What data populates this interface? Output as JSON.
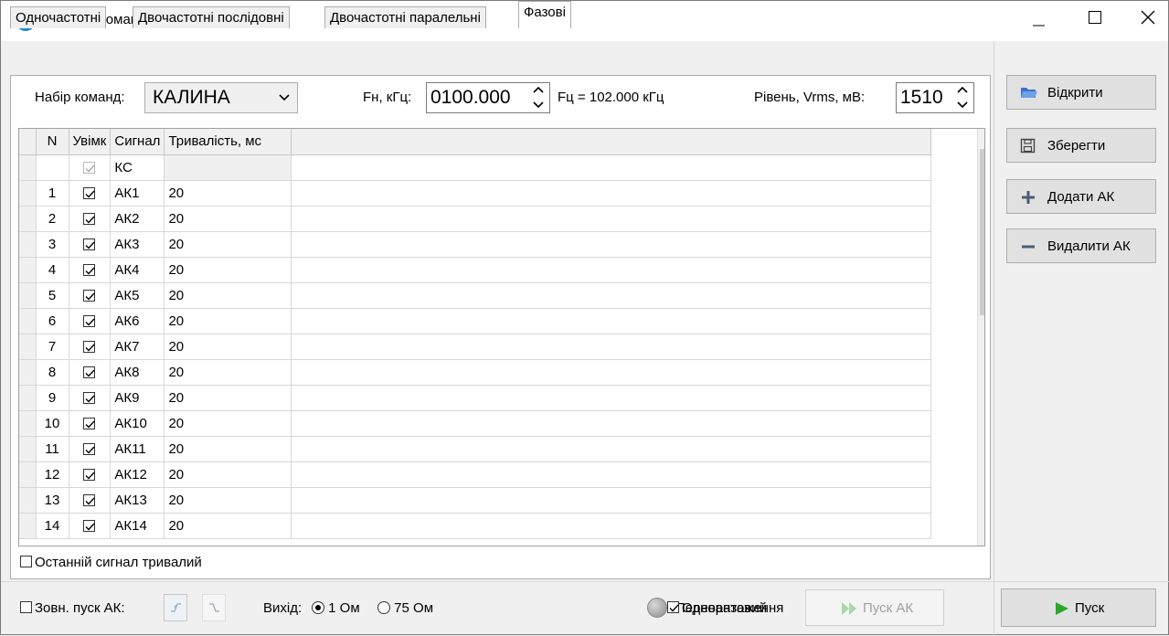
{
  "window": {
    "title": "Імітатор команд",
    "controls": [
      "minimize-icon",
      "maximize-icon",
      "close-icon"
    ]
  },
  "tabs": [
    {
      "label": "Одночастотні",
      "active": false
    },
    {
      "label": "Двочастотні послідовні",
      "active": false
    },
    {
      "label": "Двочастотні паралельні",
      "active": false
    },
    {
      "label": "Фазові",
      "active": true
    }
  ],
  "settings": {
    "command_set_label": "Набір команд:",
    "command_set_value": "КАЛИНА",
    "fn_label": "Fн, кГц:",
    "fn_value": "0100.000",
    "fc_text": "Fц = 102.000 кГц",
    "level_label": "Рівень, Vrms, мВ:",
    "level_value": "1510"
  },
  "table": {
    "columns": [
      "N",
      "Увімк",
      "Сигнал",
      "Тривалість, мс"
    ],
    "rows": [
      {
        "n": "",
        "on": true,
        "disabled": true,
        "signal": "КС",
        "duration": ""
      },
      {
        "n": "1",
        "on": true,
        "signal": "АК1",
        "duration": "20"
      },
      {
        "n": "2",
        "on": true,
        "signal": "АК2",
        "duration": "20"
      },
      {
        "n": "3",
        "on": true,
        "signal": "АК3",
        "duration": "20"
      },
      {
        "n": "4",
        "on": true,
        "signal": "АК4",
        "duration": "20"
      },
      {
        "n": "5",
        "on": true,
        "signal": "АК5",
        "duration": "20"
      },
      {
        "n": "6",
        "on": true,
        "signal": "АК6",
        "duration": "20"
      },
      {
        "n": "7",
        "on": true,
        "signal": "АК7",
        "duration": "20"
      },
      {
        "n": "8",
        "on": true,
        "signal": "АК8",
        "duration": "20"
      },
      {
        "n": "9",
        "on": true,
        "signal": "АК9",
        "duration": "20"
      },
      {
        "n": "10",
        "on": true,
        "signal": "АК10",
        "duration": "20"
      },
      {
        "n": "11",
        "on": true,
        "signal": "АК11",
        "duration": "20"
      },
      {
        "n": "12",
        "on": true,
        "signal": "АК12",
        "duration": "20"
      },
      {
        "n": "13",
        "on": true,
        "signal": "АК13",
        "duration": "20"
      },
      {
        "n": "14",
        "on": true,
        "signal": "АК14",
        "duration": "20"
      }
    ]
  },
  "last_signal_long": {
    "label": "Останній сигнал тривалий",
    "checked": false
  },
  "actions": {
    "open": "Відкрити",
    "save": "Зберегти",
    "add": "Додати АК",
    "remove": "Видалити АК"
  },
  "bottom": {
    "ext_start_label": "Зовн. пуск АК:",
    "ext_start_checked": false,
    "output_label": "Вихід:",
    "output_options": [
      {
        "label": "1 Ом",
        "selected": true
      },
      {
        "label": "75 Ом",
        "selected": false
      }
    ],
    "overload_label": "Перевантаження",
    "single_label": "Одноразовий",
    "single_checked": true,
    "start_ak_label": "Пуск АК",
    "start_label": "Пуск"
  }
}
